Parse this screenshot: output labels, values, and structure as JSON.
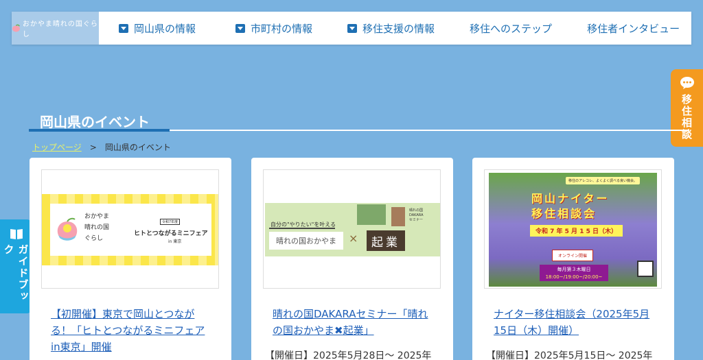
{
  "header": {
    "logo_text": "おかやま晴れの国ぐらし",
    "nav": [
      {
        "label": "岡山県の情報",
        "has_dropdown": true
      },
      {
        "label": "市町村の情報",
        "has_dropdown": true
      },
      {
        "label": "移住支援の情報",
        "has_dropdown": true
      },
      {
        "label": "移住へのステップ",
        "has_dropdown": false
      },
      {
        "label": "移住者インタビュー",
        "has_dropdown": false
      }
    ]
  },
  "consult_tab": {
    "label": "移住相談",
    "icon": "chat-bubble-icon"
  },
  "guide_tab": {
    "label": "ガイドブック",
    "icon": "book-icon"
  },
  "page": {
    "title": "岡山県のイベント",
    "breadcrumb": {
      "home": "トップページ",
      "separator": ">",
      "current": "岡山県のイベント"
    }
  },
  "cards": [
    {
      "title": "【初開催】東京で岡山とつながる！「ヒトとつながるミニフェアin東京」開催",
      "date": "",
      "thumb": {
        "lines": [
          "おかやま",
          "晴れの国",
          "ぐらし"
        ],
        "main": "ヒトとつながるミニフェア",
        "tag": "令和7年度",
        "sub": "in 東京"
      }
    },
    {
      "title": "晴れの国DAKARAセミナー「晴れの国おかやま✖起業」",
      "date": "【開催日】2025年5月28日〜 2025年",
      "thumb": {
        "head": "自分の\"やりたい\"を叶える",
        "box": "晴れの国おかやま",
        "x": "×",
        "kigyo": "起業",
        "dakara": [
          "晴れの国",
          "DAKARA",
          "セミナー"
        ]
      }
    },
    {
      "title": "ナイター移住相談会（2025年5月15日（木）開催）",
      "date": "【開催日】2025年5月15日〜 2025年",
      "thumb": {
        "tag": "移住のアレコレ、よくよく調べる良い機会。",
        "title1": "岡山ナイター",
        "title2": "移住相談会",
        "date": "令和 7 年 5 月 1 5 日（木）",
        "online": "オンライン開催",
        "monthly": "毎月第３木曜日",
        "time": "18:00~/19:00~/20:00~"
      }
    }
  ],
  "colors": {
    "background": "#79b2e0",
    "accent": "#1e6fb3",
    "orange": "#f49a1f",
    "cyan": "#1ea6de"
  }
}
